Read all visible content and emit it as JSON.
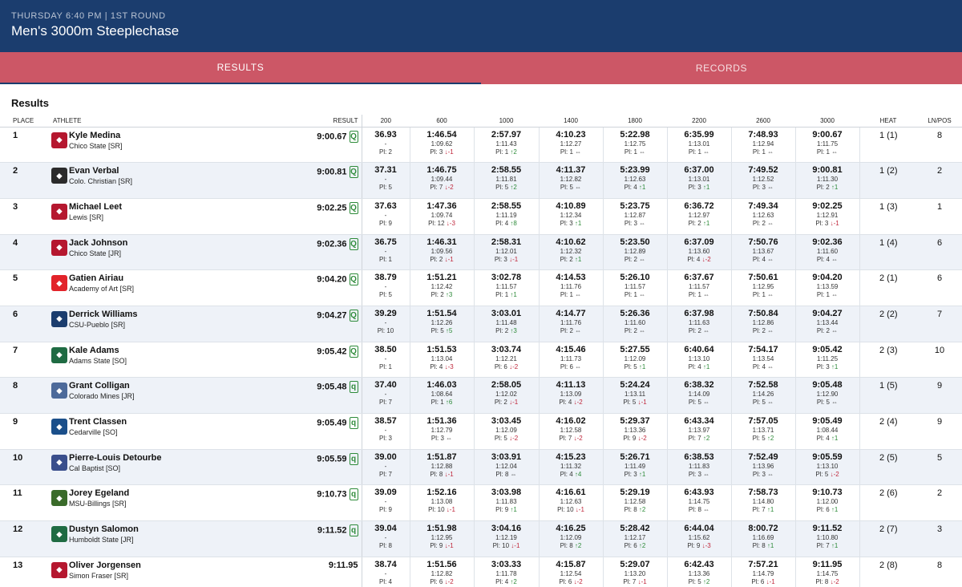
{
  "header": {
    "meta": "THURSDAY 6:40 PM | 1ST ROUND",
    "title": "Men's 3000m Steeplechase"
  },
  "tabs": [
    {
      "label": "RESULTS",
      "active": true
    },
    {
      "label": "RECORDS",
      "active": false
    }
  ],
  "section_title": "Results",
  "columns": [
    "PLACE",
    "ATHLETE",
    "RESULT",
    "200",
    "600",
    "1000",
    "1400",
    "1800",
    "2200",
    "2600",
    "3000",
    "HEAT",
    "LN/POS"
  ],
  "rows": [
    {
      "place": "1",
      "name": "Kyle Medina",
      "team": "Chico State [SR]",
      "result": "9:00.67",
      "q": "Q",
      "logo_color": "#b5172f",
      "logo_icon": "wildcat-logo",
      "splits": [
        {
          "t": "36.93",
          "lap": "-",
          "pl": "Pl: 2",
          "dir": "",
          "chg": ""
        },
        {
          "t": "1:46.54",
          "lap": "1:09.62",
          "pl": "Pl: 3",
          "dir": "down",
          "chg": "↓-1"
        },
        {
          "t": "2:57.97",
          "lap": "1:11.43",
          "pl": "Pl: 1",
          "dir": "up",
          "chg": "↑2"
        },
        {
          "t": "4:10.23",
          "lap": "1:12.27",
          "pl": "Pl: 1",
          "dir": "same",
          "chg": "⇔"
        },
        {
          "t": "5:22.98",
          "lap": "1:12.75",
          "pl": "Pl: 1",
          "dir": "same",
          "chg": "⇔"
        },
        {
          "t": "6:35.99",
          "lap": "1:13.01",
          "pl": "Pl: 1",
          "dir": "same",
          "chg": "⇔"
        },
        {
          "t": "7:48.93",
          "lap": "1:12.94",
          "pl": "Pl: 1",
          "dir": "same",
          "chg": "⇔"
        },
        {
          "t": "9:00.67",
          "lap": "1:11.75",
          "pl": "Pl: 1",
          "dir": "same",
          "chg": "⇔"
        }
      ],
      "heat": "1 (1)",
      "lane": "8"
    },
    {
      "place": "2",
      "name": "Evan Verbal",
      "team": "Colo. Christian [SR]",
      "result": "9:00.81",
      "q": "Q",
      "logo_color": "#2b2b2b",
      "logo_icon": "ccu-logo",
      "splits": [
        {
          "t": "37.31",
          "lap": "-",
          "pl": "Pl: 5",
          "dir": "",
          "chg": ""
        },
        {
          "t": "1:46.75",
          "lap": "1:09.44",
          "pl": "Pl: 7",
          "dir": "down",
          "chg": "↓-2"
        },
        {
          "t": "2:58.55",
          "lap": "1:11.81",
          "pl": "Pl: 5",
          "dir": "up",
          "chg": "↑2"
        },
        {
          "t": "4:11.37",
          "lap": "1:12.82",
          "pl": "Pl: 5",
          "dir": "same",
          "chg": "⇔"
        },
        {
          "t": "5:23.99",
          "lap": "1:12.63",
          "pl": "Pl: 4",
          "dir": "up",
          "chg": "↑1"
        },
        {
          "t": "6:37.00",
          "lap": "1:13.01",
          "pl": "Pl: 3",
          "dir": "up",
          "chg": "↑1"
        },
        {
          "t": "7:49.52",
          "lap": "1:12.52",
          "pl": "Pl: 3",
          "dir": "same",
          "chg": "⇔"
        },
        {
          "t": "9:00.81",
          "lap": "1:11.30",
          "pl": "Pl: 2",
          "dir": "up",
          "chg": "↑1"
        }
      ],
      "heat": "1 (2)",
      "lane": "2"
    },
    {
      "place": "3",
      "name": "Michael Leet",
      "team": "Lewis [SR]",
      "result": "9:02.25",
      "q": "Q",
      "logo_color": "#b5172f",
      "logo_icon": "flyer-logo",
      "splits": [
        {
          "t": "37.63",
          "lap": "-",
          "pl": "Pl: 9",
          "dir": "",
          "chg": ""
        },
        {
          "t": "1:47.36",
          "lap": "1:09.74",
          "pl": "Pl: 12",
          "dir": "down",
          "chg": "↓-3"
        },
        {
          "t": "2:58.55",
          "lap": "1:11.19",
          "pl": "Pl: 4",
          "dir": "up",
          "chg": "↑8"
        },
        {
          "t": "4:10.89",
          "lap": "1:12.34",
          "pl": "Pl: 3",
          "dir": "up",
          "chg": "↑1"
        },
        {
          "t": "5:23.75",
          "lap": "1:12.87",
          "pl": "Pl: 3",
          "dir": "same",
          "chg": "⇔"
        },
        {
          "t": "6:36.72",
          "lap": "1:12.97",
          "pl": "Pl: 2",
          "dir": "up",
          "chg": "↑1"
        },
        {
          "t": "7:49.34",
          "lap": "1:12.63",
          "pl": "Pl: 2",
          "dir": "same",
          "chg": "⇔"
        },
        {
          "t": "9:02.25",
          "lap": "1:12.91",
          "pl": "Pl: 3",
          "dir": "down",
          "chg": "↓-1"
        }
      ],
      "heat": "1 (3)",
      "lane": "1"
    },
    {
      "place": "4",
      "name": "Jack Johnson",
      "team": "Chico State [JR]",
      "result": "9:02.36",
      "q": "Q",
      "logo_color": "#b5172f",
      "logo_icon": "wildcat-logo",
      "splits": [
        {
          "t": "36.75",
          "lap": "-",
          "pl": "Pl: 1",
          "dir": "",
          "chg": ""
        },
        {
          "t": "1:46.31",
          "lap": "1:09.56",
          "pl": "Pl: 2",
          "dir": "down",
          "chg": "↓-1"
        },
        {
          "t": "2:58.31",
          "lap": "1:12.01",
          "pl": "Pl: 3",
          "dir": "down",
          "chg": "↓-1"
        },
        {
          "t": "4:10.62",
          "lap": "1:12.32",
          "pl": "Pl: 2",
          "dir": "up",
          "chg": "↑1"
        },
        {
          "t": "5:23.50",
          "lap": "1:12.89",
          "pl": "Pl: 2",
          "dir": "same",
          "chg": "⇔"
        },
        {
          "t": "6:37.09",
          "lap": "1:13.60",
          "pl": "Pl: 4",
          "dir": "down",
          "chg": "↓-2"
        },
        {
          "t": "7:50.76",
          "lap": "1:13.67",
          "pl": "Pl: 4",
          "dir": "same",
          "chg": "⇔"
        },
        {
          "t": "9:02.36",
          "lap": "1:11.60",
          "pl": "Pl: 4",
          "dir": "same",
          "chg": "⇔"
        }
      ],
      "heat": "1 (4)",
      "lane": "6"
    },
    {
      "place": "5",
      "name": "Gatien Airiau",
      "team": "Academy of Art [SR]",
      "result": "9:04.20",
      "q": "Q",
      "logo_color": "#e2232a",
      "logo_icon": "academy-logo",
      "splits": [
        {
          "t": "38.79",
          "lap": "-",
          "pl": "Pl: 5",
          "dir": "",
          "chg": ""
        },
        {
          "t": "1:51.21",
          "lap": "1:12.42",
          "pl": "Pl: 2",
          "dir": "up",
          "chg": "↑3"
        },
        {
          "t": "3:02.78",
          "lap": "1:11.57",
          "pl": "Pl: 1",
          "dir": "up",
          "chg": "↑1"
        },
        {
          "t": "4:14.53",
          "lap": "1:11.76",
          "pl": "Pl: 1",
          "dir": "same",
          "chg": "⇔"
        },
        {
          "t": "5:26.10",
          "lap": "1:11.57",
          "pl": "Pl: 1",
          "dir": "same",
          "chg": "⇔"
        },
        {
          "t": "6:37.67",
          "lap": "1:11.57",
          "pl": "Pl: 1",
          "dir": "same",
          "chg": "⇔"
        },
        {
          "t": "7:50.61",
          "lap": "1:12.95",
          "pl": "Pl: 1",
          "dir": "same",
          "chg": "⇔"
        },
        {
          "t": "9:04.20",
          "lap": "1:13.59",
          "pl": "Pl: 1",
          "dir": "same",
          "chg": "⇔"
        }
      ],
      "heat": "2 (1)",
      "lane": "6"
    },
    {
      "place": "6",
      "name": "Derrick Williams",
      "team": "CSU-Pueblo [SR]",
      "result": "9:04.27",
      "q": "Q",
      "logo_color": "#1b3d6e",
      "logo_icon": "thunderwolf-logo",
      "splits": [
        {
          "t": "39.29",
          "lap": "-",
          "pl": "Pl: 10",
          "dir": "",
          "chg": ""
        },
        {
          "t": "1:51.54",
          "lap": "1:12.26",
          "pl": "Pl: 5",
          "dir": "up",
          "chg": "↑5"
        },
        {
          "t": "3:03.01",
          "lap": "1:11.48",
          "pl": "Pl: 2",
          "dir": "up",
          "chg": "↑3"
        },
        {
          "t": "4:14.77",
          "lap": "1:11.76",
          "pl": "Pl: 2",
          "dir": "same",
          "chg": "⇔"
        },
        {
          "t": "5:26.36",
          "lap": "1:11.60",
          "pl": "Pl: 2",
          "dir": "same",
          "chg": "⇔"
        },
        {
          "t": "6:37.98",
          "lap": "1:11.63",
          "pl": "Pl: 2",
          "dir": "same",
          "chg": "⇔"
        },
        {
          "t": "7:50.84",
          "lap": "1:12.86",
          "pl": "Pl: 2",
          "dir": "same",
          "chg": "⇔"
        },
        {
          "t": "9:04.27",
          "lap": "1:13.44",
          "pl": "Pl: 2",
          "dir": "same",
          "chg": "⇔"
        }
      ],
      "heat": "2 (2)",
      "lane": "7"
    },
    {
      "place": "7",
      "name": "Kale Adams",
      "team": "Adams State [SO]",
      "result": "9:05.42",
      "q": "Q",
      "logo_color": "#1f6b43",
      "logo_icon": "grizzly-logo",
      "splits": [
        {
          "t": "38.50",
          "lap": "-",
          "pl": "Pl: 1",
          "dir": "",
          "chg": ""
        },
        {
          "t": "1:51.53",
          "lap": "1:13.04",
          "pl": "Pl: 4",
          "dir": "down",
          "chg": "↓-3"
        },
        {
          "t": "3:03.74",
          "lap": "1:12.21",
          "pl": "Pl: 6",
          "dir": "down",
          "chg": "↓-2"
        },
        {
          "t": "4:15.46",
          "lap": "1:11.73",
          "pl": "Pl: 6",
          "dir": "same",
          "chg": "⇔"
        },
        {
          "t": "5:27.55",
          "lap": "1:12.09",
          "pl": "Pl: 5",
          "dir": "up",
          "chg": "↑1"
        },
        {
          "t": "6:40.64",
          "lap": "1:13.10",
          "pl": "Pl: 4",
          "dir": "up",
          "chg": "↑1"
        },
        {
          "t": "7:54.17",
          "lap": "1:13.54",
          "pl": "Pl: 4",
          "dir": "same",
          "chg": "⇔"
        },
        {
          "t": "9:05.42",
          "lap": "1:11.25",
          "pl": "Pl: 3",
          "dir": "up",
          "chg": "↑1"
        }
      ],
      "heat": "2 (3)",
      "lane": "10"
    },
    {
      "place": "8",
      "name": "Grant Colligan",
      "team": "Colorado Mines [JR]",
      "result": "9:05.48",
      "q": "q",
      "logo_color": "#4d6a9a",
      "logo_icon": "orediggers-logo",
      "splits": [
        {
          "t": "37.40",
          "lap": "-",
          "pl": "Pl: 7",
          "dir": "",
          "chg": ""
        },
        {
          "t": "1:46.03",
          "lap": "1:08.64",
          "pl": "Pl: 1",
          "dir": "up",
          "chg": "↑6"
        },
        {
          "t": "2:58.05",
          "lap": "1:12.02",
          "pl": "Pl: 2",
          "dir": "down",
          "chg": "↓-1"
        },
        {
          "t": "4:11.13",
          "lap": "1:13.09",
          "pl": "Pl: 4",
          "dir": "down",
          "chg": "↓-2"
        },
        {
          "t": "5:24.24",
          "lap": "1:13.11",
          "pl": "Pl: 5",
          "dir": "down",
          "chg": "↓-1"
        },
        {
          "t": "6:38.32",
          "lap": "1:14.09",
          "pl": "Pl: 5",
          "dir": "same",
          "chg": "⇔"
        },
        {
          "t": "7:52.58",
          "lap": "1:14.26",
          "pl": "Pl: 5",
          "dir": "same",
          "chg": "⇔"
        },
        {
          "t": "9:05.48",
          "lap": "1:12.90",
          "pl": "Pl: 5",
          "dir": "same",
          "chg": "⇔"
        }
      ],
      "heat": "1 (5)",
      "lane": "9"
    },
    {
      "place": "9",
      "name": "Trent Classen",
      "team": "Cedarville [SO]",
      "result": "9:05.49",
      "q": "q",
      "logo_color": "#1b4f8a",
      "logo_icon": "yellow-jacket-logo",
      "splits": [
        {
          "t": "38.57",
          "lap": "-",
          "pl": "Pl: 3",
          "dir": "",
          "chg": ""
        },
        {
          "t": "1:51.36",
          "lap": "1:12.79",
          "pl": "Pl: 3",
          "dir": "same",
          "chg": "⇔"
        },
        {
          "t": "3:03.45",
          "lap": "1:12.09",
          "pl": "Pl: 5",
          "dir": "down",
          "chg": "↓-2"
        },
        {
          "t": "4:16.02",
          "lap": "1:12.58",
          "pl": "Pl: 7",
          "dir": "down",
          "chg": "↓-2"
        },
        {
          "t": "5:29.37",
          "lap": "1:13.36",
          "pl": "Pl: 9",
          "dir": "down",
          "chg": "↓-2"
        },
        {
          "t": "6:43.34",
          "lap": "1:13.97",
          "pl": "Pl: 7",
          "dir": "up",
          "chg": "↑2"
        },
        {
          "t": "7:57.05",
          "lap": "1:13.71",
          "pl": "Pl: 5",
          "dir": "up",
          "chg": "↑2"
        },
        {
          "t": "9:05.49",
          "lap": "1:08.44",
          "pl": "Pl: 4",
          "dir": "up",
          "chg": "↑1"
        }
      ],
      "heat": "2 (4)",
      "lane": "9"
    },
    {
      "place": "10",
      "name": "Pierre-Louis Detourbe",
      "team": "Cal Baptist [SO]",
      "result": "9:05.59",
      "q": "q",
      "logo_color": "#3a4f8c",
      "logo_icon": "lancers-logo",
      "splits": [
        {
          "t": "39.00",
          "lap": "-",
          "pl": "Pl: 7",
          "dir": "",
          "chg": ""
        },
        {
          "t": "1:51.87",
          "lap": "1:12.88",
          "pl": "Pl: 8",
          "dir": "down",
          "chg": "↓-1"
        },
        {
          "t": "3:03.91",
          "lap": "1:12.04",
          "pl": "Pl: 8",
          "dir": "same",
          "chg": "⇔"
        },
        {
          "t": "4:15.23",
          "lap": "1:11.32",
          "pl": "Pl: 4",
          "dir": "up",
          "chg": "↑4"
        },
        {
          "t": "5:26.71",
          "lap": "1:11.49",
          "pl": "Pl: 3",
          "dir": "up",
          "chg": "↑1"
        },
        {
          "t": "6:38.53",
          "lap": "1:11.83",
          "pl": "Pl: 3",
          "dir": "same",
          "chg": "⇔"
        },
        {
          "t": "7:52.49",
          "lap": "1:13.96",
          "pl": "Pl: 3",
          "dir": "same",
          "chg": "⇔"
        },
        {
          "t": "9:05.59",
          "lap": "1:13.10",
          "pl": "Pl: 5",
          "dir": "down",
          "chg": "↓-2"
        }
      ],
      "heat": "2 (5)",
      "lane": "5"
    },
    {
      "place": "11",
      "name": "Jorey Egeland",
      "team": "MSU-Billings [SR]",
      "result": "9:10.73",
      "q": "q",
      "logo_color": "#3a6b2a",
      "logo_icon": "yellowjacket-logo",
      "splits": [
        {
          "t": "39.09",
          "lap": "-",
          "pl": "Pl: 9",
          "dir": "",
          "chg": ""
        },
        {
          "t": "1:52.16",
          "lap": "1:13.08",
          "pl": "Pl: 10",
          "dir": "down",
          "chg": "↓-1"
        },
        {
          "t": "3:03.98",
          "lap": "1:11.83",
          "pl": "Pl: 9",
          "dir": "up",
          "chg": "↑1"
        },
        {
          "t": "4:16.61",
          "lap": "1:12.63",
          "pl": "Pl: 10",
          "dir": "down",
          "chg": "↓-1"
        },
        {
          "t": "5:29.19",
          "lap": "1:12.58",
          "pl": "Pl: 8",
          "dir": "up",
          "chg": "↑2"
        },
        {
          "t": "6:43.93",
          "lap": "1:14.75",
          "pl": "Pl: 8",
          "dir": "same",
          "chg": "⇔"
        },
        {
          "t": "7:58.73",
          "lap": "1:14.80",
          "pl": "Pl: 7",
          "dir": "up",
          "chg": "↑1"
        },
        {
          "t": "9:10.73",
          "lap": "1:12.00",
          "pl": "Pl: 6",
          "dir": "up",
          "chg": "↑1"
        }
      ],
      "heat": "2 (6)",
      "lane": "2"
    },
    {
      "place": "12",
      "name": "Dustyn Salomon",
      "team": "Humboldt State [JR]",
      "result": "9:11.52",
      "q": "q",
      "logo_color": "#1f6b43",
      "logo_icon": "lumberjack-logo",
      "splits": [
        {
          "t": "39.04",
          "lap": "-",
          "pl": "Pl: 8",
          "dir": "",
          "chg": ""
        },
        {
          "t": "1:51.98",
          "lap": "1:12.95",
          "pl": "Pl: 9",
          "dir": "down",
          "chg": "↓-1"
        },
        {
          "t": "3:04.16",
          "lap": "1:12.19",
          "pl": "Pl: 10",
          "dir": "down",
          "chg": "↓-1"
        },
        {
          "t": "4:16.25",
          "lap": "1:12.09",
          "pl": "Pl: 8",
          "dir": "up",
          "chg": "↑2"
        },
        {
          "t": "5:28.42",
          "lap": "1:12.17",
          "pl": "Pl: 6",
          "dir": "up",
          "chg": "↑2"
        },
        {
          "t": "6:44.04",
          "lap": "1:15.62",
          "pl": "Pl: 9",
          "dir": "down",
          "chg": "↓-3"
        },
        {
          "t": "8:00.72",
          "lap": "1:16.69",
          "pl": "Pl: 8",
          "dir": "up",
          "chg": "↑1"
        },
        {
          "t": "9:11.52",
          "lap": "1:10.80",
          "pl": "Pl: 7",
          "dir": "up",
          "chg": "↑1"
        }
      ],
      "heat": "2 (7)",
      "lane": "3"
    },
    {
      "place": "13",
      "name": "Oliver Jorgensen",
      "team": "Simon Fraser [SR]",
      "result": "9:11.95",
      "q": "",
      "logo_color": "#b5172f",
      "logo_icon": "sfu-logo",
      "splits": [
        {
          "t": "38.74",
          "lap": "-",
          "pl": "Pl: 4",
          "dir": "",
          "chg": ""
        },
        {
          "t": "1:51.56",
          "lap": "1:12.82",
          "pl": "Pl: 6",
          "dir": "down",
          "chg": "↓-2"
        },
        {
          "t": "3:03.33",
          "lap": "1:11.78",
          "pl": "Pl: 4",
          "dir": "up",
          "chg": "↑2"
        },
        {
          "t": "4:15.87",
          "lap": "1:12.54",
          "pl": "Pl: 6",
          "dir": "down",
          "chg": "↓-2"
        },
        {
          "t": "5:29.07",
          "lap": "1:13.20",
          "pl": "Pl: 7",
          "dir": "down",
          "chg": "↓-1"
        },
        {
          "t": "6:42.43",
          "lap": "1:13.36",
          "pl": "Pl: 5",
          "dir": "up",
          "chg": "↑2"
        },
        {
          "t": "7:57.21",
          "lap": "1:14.79",
          "pl": "Pl: 6",
          "dir": "down",
          "chg": "↓-1"
        },
        {
          "t": "9:11.95",
          "lap": "1:14.75",
          "pl": "Pl: 8",
          "dir": "down",
          "chg": "↓-2"
        }
      ],
      "heat": "2 (8)",
      "lane": "8"
    }
  ]
}
